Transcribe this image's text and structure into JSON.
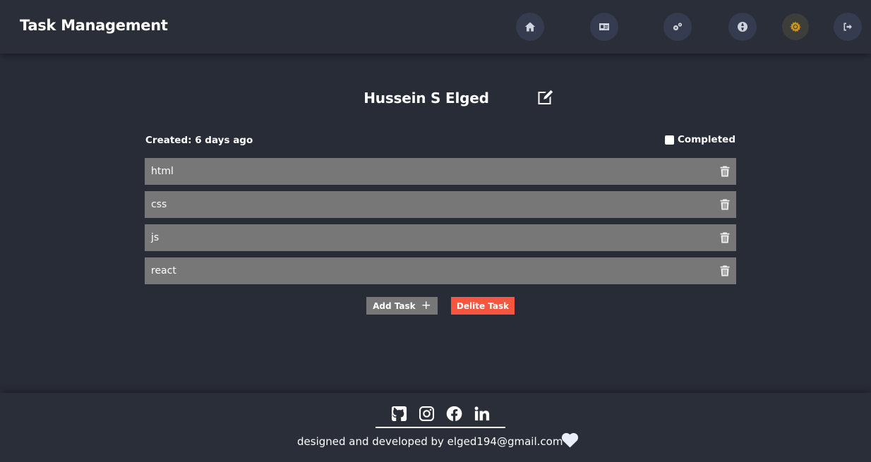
{
  "header": {
    "title": "Task Management",
    "nav": [
      {
        "name": "home",
        "icon": "home-icon"
      },
      {
        "name": "profile",
        "icon": "id-card-icon"
      },
      {
        "name": "settings",
        "icon": "gears-icon"
      },
      {
        "name": "language",
        "icon": "globe-icon"
      },
      {
        "name": "theme",
        "icon": "sun-icon",
        "active": true
      },
      {
        "name": "logout",
        "icon": "sign-out-icon"
      }
    ]
  },
  "main": {
    "title": "Hussein S Elged",
    "created_label": "Created: 6 days ago",
    "completed_label": "Completed",
    "completed_checked": false,
    "tasks": [
      "html",
      "css",
      "js",
      "react"
    ],
    "add_label": "Add Task",
    "add_icon": "+",
    "delete_label": "Delite Task"
  },
  "footer": {
    "socials": [
      "github-icon",
      "instagram-icon",
      "facebook-icon",
      "linkedin-icon"
    ],
    "credit": "designed and developed by elged194@gmail.com",
    "heart_icon": "heart-icon"
  },
  "colors": {
    "background": "#282c36",
    "header": "#2a2e38",
    "nav_button": "#363c4f",
    "task_row": "#777777",
    "delete_button": "#f4573e",
    "active_icon": "#c99420"
  }
}
